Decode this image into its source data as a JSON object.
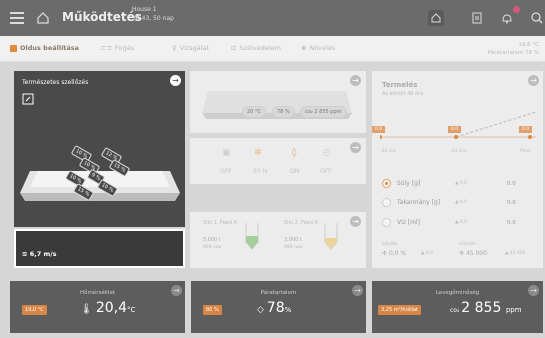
{
  "topbar": {
    "title": "Működtetés",
    "house": "House 1",
    "age": "38:43, 50 nap"
  },
  "nav": {
    "items": [
      {
        "label": "Oldus beállítása",
        "active": true
      },
      {
        "label": "Fogás",
        "active": false
      },
      {
        "label": "Vizsgálat",
        "active": false
      },
      {
        "label": "Szélvédelem",
        "active": false
      },
      {
        "label": "Növelés",
        "active": false
      }
    ],
    "right_temp": "19,6 °C",
    "right_label": "Páratartalom 78 %"
  },
  "vent": {
    "title": "Természetes szellőzés",
    "wind": "6,7 m/s",
    "tags": [
      "10 %",
      "12 %",
      "10 %",
      "15 %",
      "9 %",
      "10 %",
      "10 %",
      "15 %"
    ]
  },
  "house_panel": {
    "pills": [
      "20 °C",
      "78 %",
      "co₂ 2 855 ppm"
    ]
  },
  "actuators": [
    {
      "label": "OFF",
      "icon": "heater-icon"
    },
    {
      "label": "50 lx",
      "icon": "light-icon"
    },
    {
      "label": "ON",
      "icon": "water-icon"
    },
    {
      "label": "OFF",
      "icon": "timer-icon"
    }
  ],
  "silos": [
    {
      "name": "Silo 1, Feed A",
      "amount": "5,000 t",
      "days": "999 nap"
    },
    {
      "name": "Silo 2, Feed A",
      "amount": "3,000 t",
      "days": "999 nap"
    }
  ],
  "production": {
    "title": "Termelés",
    "subtitle": "Az elmúlt 48 óra",
    "badges": [
      "0.0",
      "0.0",
      "0.0"
    ],
    "xlabels": [
      "-48 óra",
      "-24 óra",
      "Most"
    ],
    "rows": [
      {
        "label": "Súly [g]",
        "delta": "▲ 0.0",
        "value": "0.0"
      },
      {
        "label": "Takarmány [g]",
        "delta": "▲ 0.0",
        "value": "0.0"
      },
      {
        "label": "Víz [ml]",
        "delta": "▲ 0.0",
        "value": "0.0"
      }
    ],
    "footer_left_label": "Elhullás",
    "footer_left_value": "0,0 %",
    "footer_left_delta": "▲ 0.0",
    "footer_right_label": "Létszám",
    "footer_right_value": "45 000",
    "footer_right_delta": "▲ 45 000"
  },
  "bottom": [
    {
      "title": "Hőmérséklet",
      "badge": "19,0 °C",
      "value": "20,4",
      "unit": "°C"
    },
    {
      "title": "Páratartalom",
      "badge": "80 %",
      "value": "78",
      "unit": "%"
    },
    {
      "title": "Levegőminőség",
      "badge": "3,25 m³/h/állat",
      "value": "2 855",
      "unit": "ppm"
    }
  ],
  "colors": {
    "accent": "#e28a3a",
    "dark": "#4a4a4a",
    "topbar": "#6b6b6b"
  }
}
